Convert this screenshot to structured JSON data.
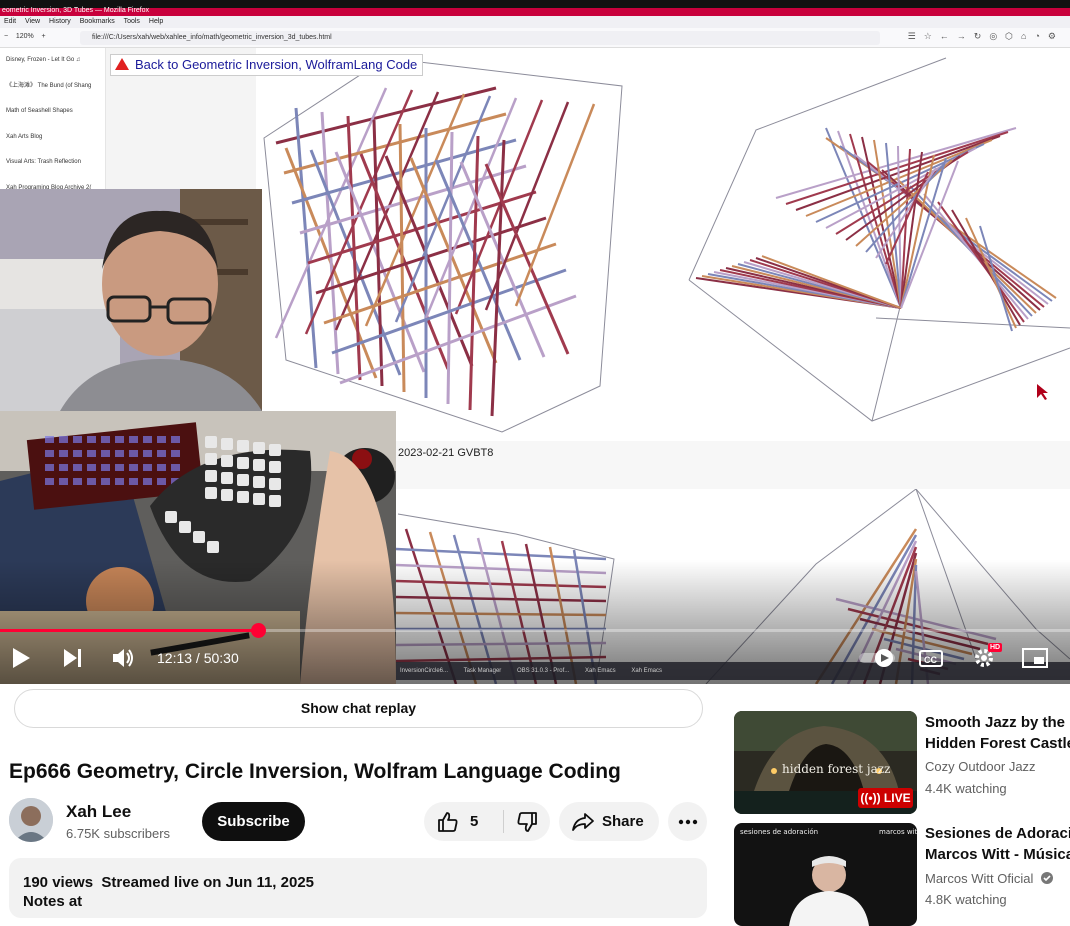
{
  "firefox": {
    "title": "eometric Inversion, 3D Tubes — Mozilla Firefox",
    "menu": [
      "Edit",
      "View",
      "History",
      "Bookmarks",
      "Tools",
      "Help"
    ],
    "zoom": "120%",
    "url": "file:///C:/Users/xah/web/xahlee_info/math/geometric_inversion_3d_tubes.html"
  },
  "bookmarks_sidebar": [
    "Disney, Frozen - Let It Go ♫",
    "《上海滩》 The Bund (of Shang",
    "Math of Seashell Shapes",
    "Xah Arts Blog",
    "Visual Arts: Trash Reflection",
    "Xah Programing Blog Archive 2("
  ],
  "page_content": {
    "back_link": "Back to Geometric Inversion, WolframLang Code",
    "date_label": "2023-02-21 GVBT8"
  },
  "taskbar_items": [
    "InversionCircle6...",
    "Task Manager",
    "OBS 31.0.3 - Prof...",
    "Xah Emacs",
    "Xah Emacs"
  ],
  "player": {
    "time_current": "12:13",
    "time_total": "50:30",
    "time_label": "12:13 / 50:30",
    "progress": 0.2418,
    "hd_badge": "HD"
  },
  "chat_replay_label": "Show chat replay",
  "video": {
    "title": "Ep666 Geometry, Circle Inversion, Wolfram Language Coding",
    "channel_name": "Xah Lee",
    "subscribers": "6.75K subscribers",
    "subscribe_label": "Subscribe",
    "likes": "5",
    "share_label": "Share",
    "description_meta": "190 views  Streamed live on Jun 11, 2025",
    "description_notes": "Notes at"
  },
  "recommendations": [
    {
      "title_line1": "Smooth Jazz by the F",
      "title_line2": "Hidden Forest Castle",
      "channel": "Cozy Outdoor Jazz",
      "meta": "4.4K watching",
      "badge": "LIVE",
      "thumb_text": "hidden forest jazz"
    },
    {
      "title_line1": "Sesiones de Adoració",
      "title_line2": "Marcos Witt - Música",
      "channel": "Marcos Witt Oficial",
      "meta": "4.8K watching",
      "thumb_text_left": "sesiones de adoración",
      "thumb_text_right": "marcos witt"
    }
  ],
  "colors": {
    "accent_red": "#ff0033",
    "firefox_titlebar": "#c8003c",
    "subscribe_bg": "#0f0f0f"
  }
}
